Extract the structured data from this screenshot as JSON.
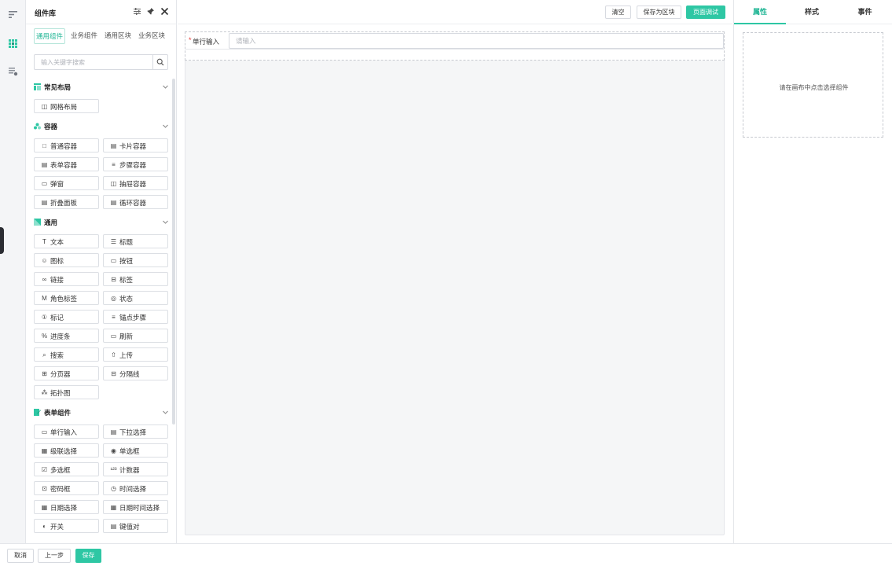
{
  "rail": {
    "items": [
      {
        "icon": "outline-icon"
      },
      {
        "icon": "component-library-icon",
        "active": true
      },
      {
        "icon": "data-settings-icon"
      }
    ]
  },
  "library": {
    "title": "组件库",
    "tabs": [
      "通用组件",
      "业务组件",
      "通用区块",
      "业务区块"
    ],
    "search_placeholder": "输入关键字搜索",
    "sections": [
      {
        "title": "常见布局",
        "icon_color": "#2ec7a4",
        "items": [
          {
            "glyph": "◫",
            "label": "网格布局"
          }
        ]
      },
      {
        "title": "容器",
        "icon_color": "#2ec7a4",
        "items": [
          {
            "glyph": "□",
            "label": "普通容器"
          },
          {
            "glyph": "▤",
            "label": "卡片容器"
          },
          {
            "glyph": "▤",
            "label": "表单容器"
          },
          {
            "glyph": "≡",
            "label": "步骤容器"
          },
          {
            "glyph": "▭",
            "label": "弹窗"
          },
          {
            "glyph": "◫",
            "label": "抽屉容器"
          },
          {
            "glyph": "▤",
            "label": "折叠面板"
          },
          {
            "glyph": "▤",
            "label": "循环容器"
          }
        ]
      },
      {
        "title": "通用",
        "icon_color": "#2ec7a4",
        "items": [
          {
            "glyph": "T",
            "label": "文本"
          },
          {
            "glyph": "☰",
            "label": "标题"
          },
          {
            "glyph": "☺",
            "label": "图标"
          },
          {
            "glyph": "▭",
            "label": "按钮"
          },
          {
            "glyph": "∞",
            "label": "链接"
          },
          {
            "glyph": "⊟",
            "label": "标签"
          },
          {
            "glyph": "M",
            "label": "角色标签"
          },
          {
            "glyph": "◎",
            "label": "状态"
          },
          {
            "glyph": "①",
            "label": "标记"
          },
          {
            "glyph": "≡",
            "label": "锚点步骤"
          },
          {
            "glyph": "%",
            "label": "进度条"
          },
          {
            "glyph": "▭",
            "label": "刷新"
          },
          {
            "glyph": "⌕",
            "label": "搜索"
          },
          {
            "glyph": "⇧",
            "label": "上传"
          },
          {
            "glyph": "⊞",
            "label": "分页器"
          },
          {
            "glyph": "⊟",
            "label": "分隔线"
          },
          {
            "glyph": "⁂",
            "label": "拓扑图"
          }
        ]
      },
      {
        "title": "表单组件",
        "icon_color": "#2ec7a4",
        "items": [
          {
            "glyph": "▭",
            "label": "单行输入"
          },
          {
            "glyph": "▤",
            "label": "下拉选择"
          },
          {
            "glyph": "▦",
            "label": "级联选择"
          },
          {
            "glyph": "◉",
            "label": "单选框"
          },
          {
            "glyph": "☑",
            "label": "多选框"
          },
          {
            "glyph": "¹²³",
            "label": "计数器"
          },
          {
            "glyph": "⊡",
            "label": "密码框"
          },
          {
            "glyph": "◷",
            "label": "时间选择"
          },
          {
            "glyph": "▦",
            "label": "日期选择"
          },
          {
            "glyph": "▦",
            "label": "日期时间选择"
          },
          {
            "glyph": "◐",
            "label": "开关"
          },
          {
            "glyph": "▤",
            "label": "键值对"
          }
        ]
      }
    ]
  },
  "toolbar": {
    "clear_label": "清空",
    "save_block_label": "保存为区块",
    "debug_label": "页面调试"
  },
  "canvas": {
    "field": {
      "required_mark": "*",
      "label": "单行输入",
      "placeholder": "请输入"
    }
  },
  "properties": {
    "tabs": [
      "属性",
      "样式",
      "事件"
    ],
    "active_tab": "属性",
    "empty_text": "请在画布中点击选择组件"
  },
  "footer": {
    "cancel_label": "取消",
    "prev_label": "上一步",
    "save_label": "保存"
  },
  "colors": {
    "accent": "#2ec7a4",
    "required": "#e53935"
  }
}
